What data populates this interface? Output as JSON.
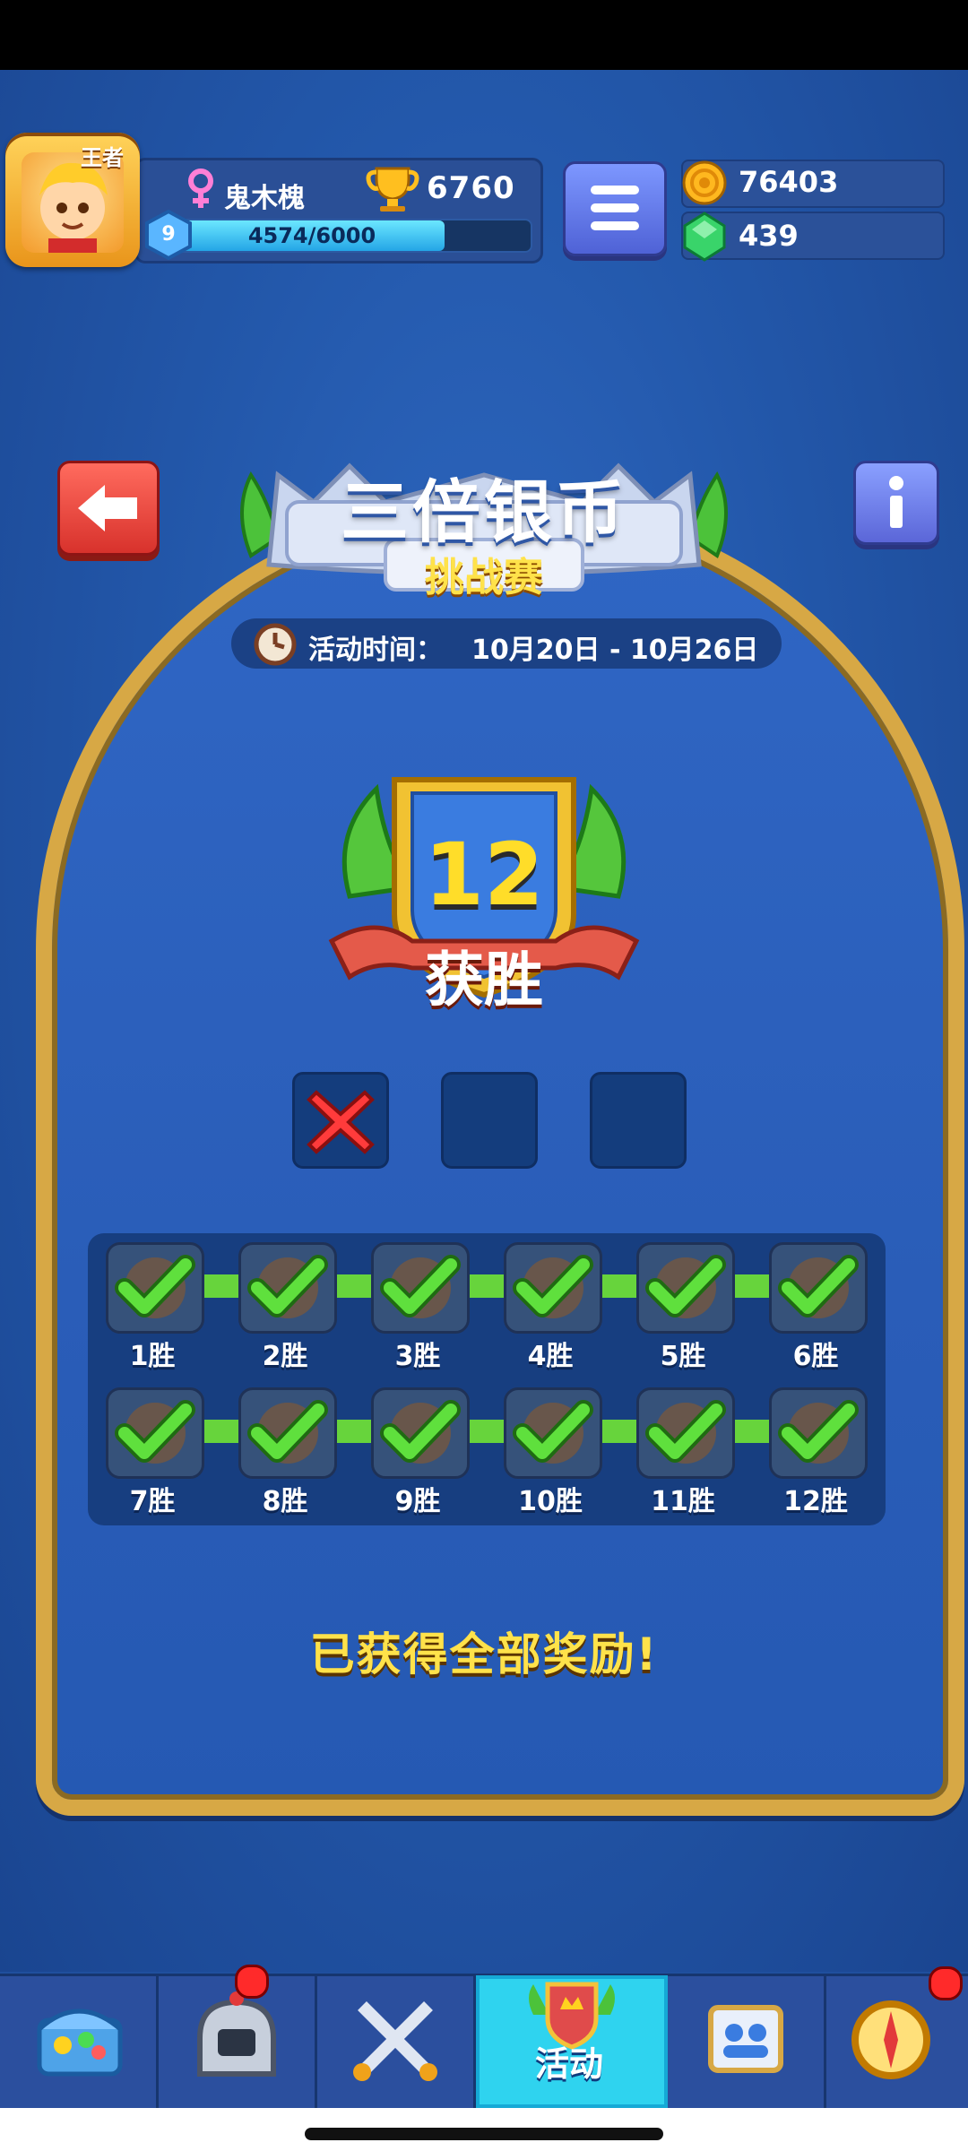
{
  "profile": {
    "rank_label": "王者",
    "name": "鬼木槐",
    "trophies": "6760",
    "level": "9",
    "xp_text": "4574/6000",
    "xp_progress": 0.762
  },
  "currencies": {
    "coins": "76403",
    "gems": "439"
  },
  "event": {
    "title": "三倍银币",
    "subtitle": "挑战赛",
    "time_label": "活动时间：",
    "time_value": "10月20日 - 10月26日"
  },
  "result": {
    "wins": "12",
    "wins_label": "获胜"
  },
  "attempts": [
    {
      "state": "failed"
    },
    {
      "state": "empty"
    },
    {
      "state": "empty"
    }
  ],
  "progress": {
    "rows": [
      [
        {
          "label": "1胜",
          "claimed": true
        },
        {
          "label": "2胜",
          "claimed": true
        },
        {
          "label": "3胜",
          "claimed": true
        },
        {
          "label": "4胜",
          "claimed": true
        },
        {
          "label": "5胜",
          "claimed": true
        },
        {
          "label": "6胜",
          "claimed": true
        }
      ],
      [
        {
          "label": "7胜",
          "claimed": true
        },
        {
          "label": "8胜",
          "claimed": true
        },
        {
          "label": "9胜",
          "claimed": true
        },
        {
          "label": "10胜",
          "claimed": true
        },
        {
          "label": "11胜",
          "claimed": true
        },
        {
          "label": "12胜",
          "claimed": true
        }
      ]
    ]
  },
  "status": {
    "message": "已获得全部奖励!"
  },
  "bottom_nav": {
    "items": [
      {
        "icon": "treasure-chest-icon"
      },
      {
        "icon": "knight-helmet-icon",
        "badge": true
      },
      {
        "icon": "crossed-swords-icon"
      },
      {
        "icon": "event-shield-icon",
        "label": "活动",
        "active": true
      },
      {
        "icon": "social-clan-icon"
      },
      {
        "icon": "compass-icon",
        "badge": true
      }
    ]
  },
  "colors": {
    "accent_gold": "#d7a845",
    "check_green": "#4bd23a",
    "active_tab": "#2fd3ef"
  }
}
